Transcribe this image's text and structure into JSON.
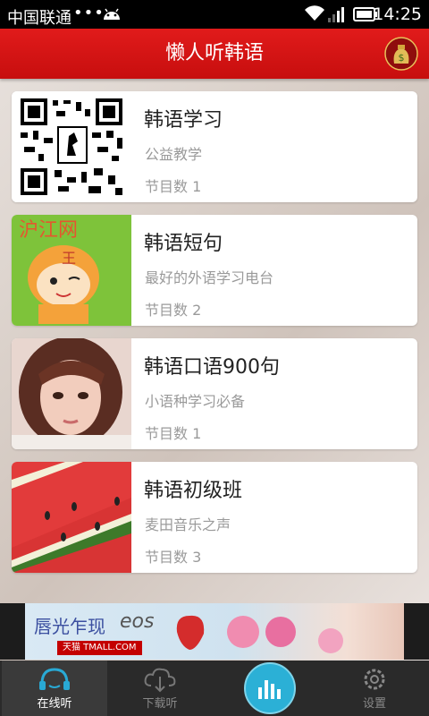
{
  "status_bar": {
    "carrier": "中国联通",
    "dots": "•••",
    "time": "14:25",
    "icons": [
      "android-icon",
      "wifi-icon",
      "signal-icon",
      "battery-icon"
    ]
  },
  "header": {
    "title": "懒人听韩语",
    "coin_icon": "money-bag-icon"
  },
  "programs": [
    {
      "title": "韩语学习",
      "subtitle": "公益教学",
      "count": "节目数 1",
      "thumb": "qr-code"
    },
    {
      "title": "韩语短句",
      "subtitle": "最好的外语学习电台",
      "count": "节目数 2",
      "thumb": "hujiang-mascot",
      "thumb_text": "沪江网"
    },
    {
      "title": "韩语口语900句",
      "subtitle": "小语种学习必备",
      "count": "节目数 1",
      "thumb": "girl-portrait"
    },
    {
      "title": "韩语初级班",
      "subtitle": "麦田音乐之声",
      "count": "节目数 3",
      "thumb": "watermelon"
    }
  ],
  "ad": {
    "headline": "唇光乍现",
    "brand": "eos",
    "store": "天猫 TMALL.COM"
  },
  "tabs": [
    {
      "label": "在线听",
      "icon": "headphones-cloud-icon",
      "active": true
    },
    {
      "label": "下载听",
      "icon": "cloud-download-icon",
      "active": false
    },
    {
      "label": "",
      "icon": "equalizer-icon",
      "active": false
    },
    {
      "label": "设置",
      "icon": "gear-icon",
      "active": false
    }
  ],
  "colors": {
    "header": "#d51414",
    "accent": "#2bb0d6",
    "tabbar": "#2a2a2a"
  }
}
